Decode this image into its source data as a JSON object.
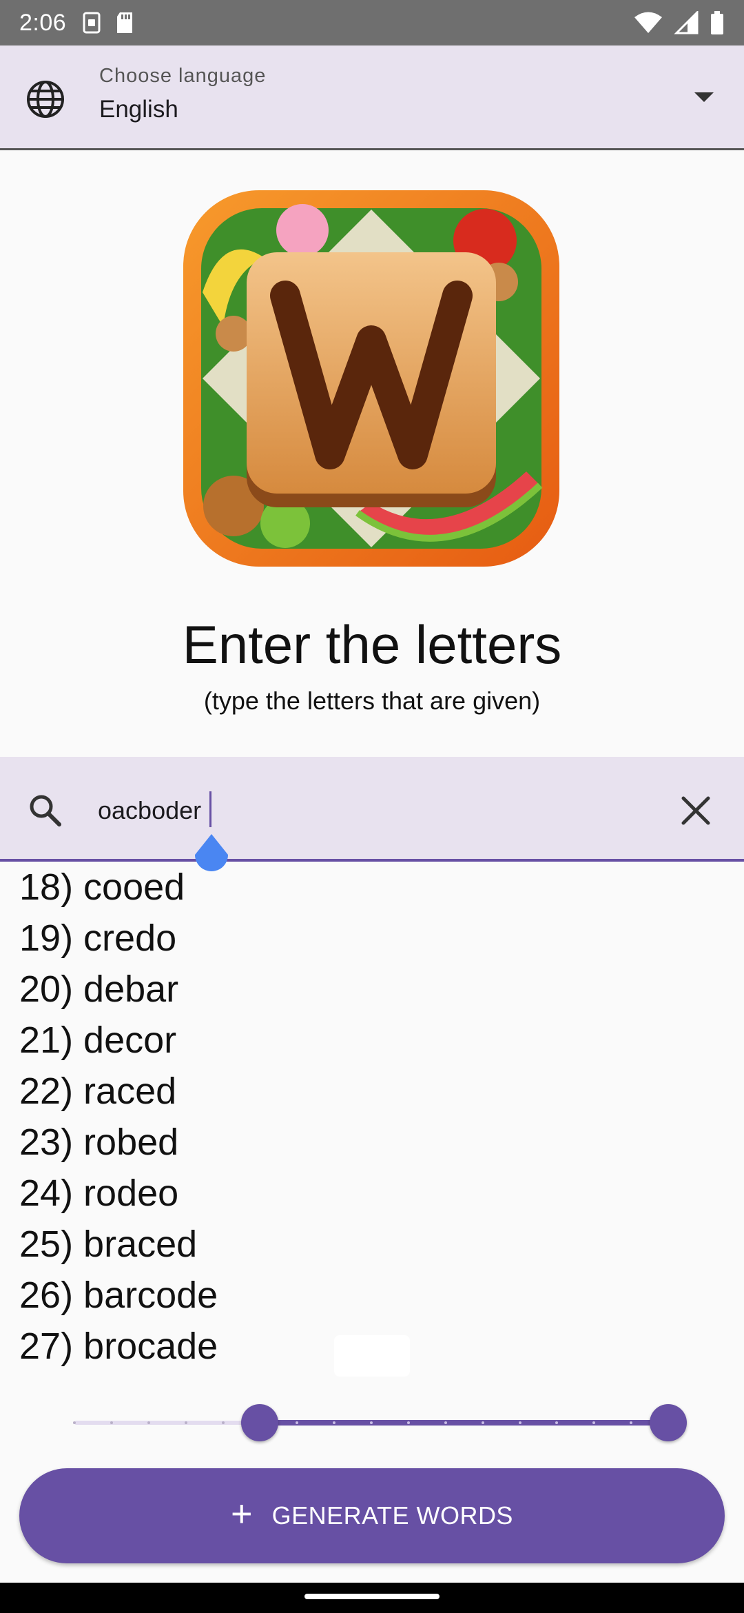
{
  "status_bar": {
    "time": "2:06",
    "icons_left": [
      "sim-icon",
      "sd-card-icon"
    ],
    "icons_right": [
      "wifi-icon",
      "signal-icon",
      "battery-icon"
    ]
  },
  "language_selector": {
    "caption": "Choose language",
    "value": "English"
  },
  "header": {
    "title": "Enter the letters",
    "subtitle": "(type the letters that are given)"
  },
  "search": {
    "value": "oacboder"
  },
  "words": [
    "18) cooed",
    "19) credo",
    "20) debar",
    "21) decor",
    "22) raced",
    "23) robed",
    "24) rodeo",
    "25) braced",
    "26) barcode",
    "27) brocade"
  ],
  "slider": {
    "min": 1,
    "max": 17,
    "range_start": 6,
    "range_end": 17
  },
  "generate_button": {
    "label": "GENERATE WORDS",
    "icon": "plus-icon"
  },
  "colors": {
    "accent": "#6750a4",
    "surface_tint": "#e8e2ef",
    "caret_handle": "#4a86f2"
  }
}
